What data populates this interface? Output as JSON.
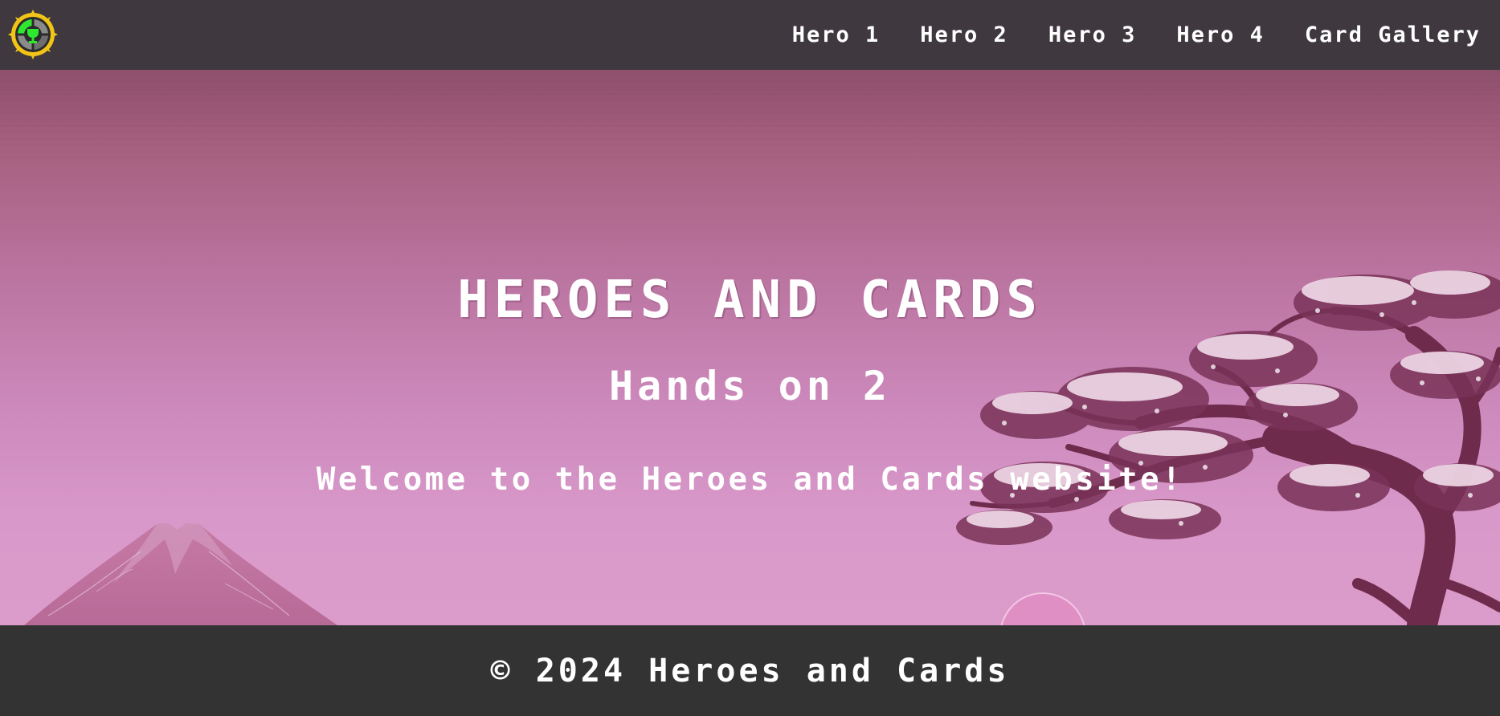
{
  "header": {
    "logo_icon": "trophy-crosshair-logo-icon",
    "nav": [
      {
        "label": "Hero 1"
      },
      {
        "label": "Hero 2"
      },
      {
        "label": "Hero 3"
      },
      {
        "label": "Hero 4"
      },
      {
        "label": "Card Gallery"
      }
    ]
  },
  "hero": {
    "title": "HEROES AND CARDS",
    "subtitle": "Hands on 2",
    "welcome": "Welcome to the Heroes and Cards website!",
    "background_icons": [
      "mountain-icon",
      "cherry-blossom-tree-icon",
      "setting-sun-icon"
    ]
  },
  "footer": {
    "copyright": "© 2024 Heroes and Cards"
  },
  "colors": {
    "header_bg": "#3f383e",
    "footer_bg": "#333333",
    "hero_top": "#8e506c",
    "hero_bottom": "#dc9ccb",
    "text": "#ffffff",
    "logo_ring": "#f2c418",
    "logo_accent": "#2ee82e"
  }
}
